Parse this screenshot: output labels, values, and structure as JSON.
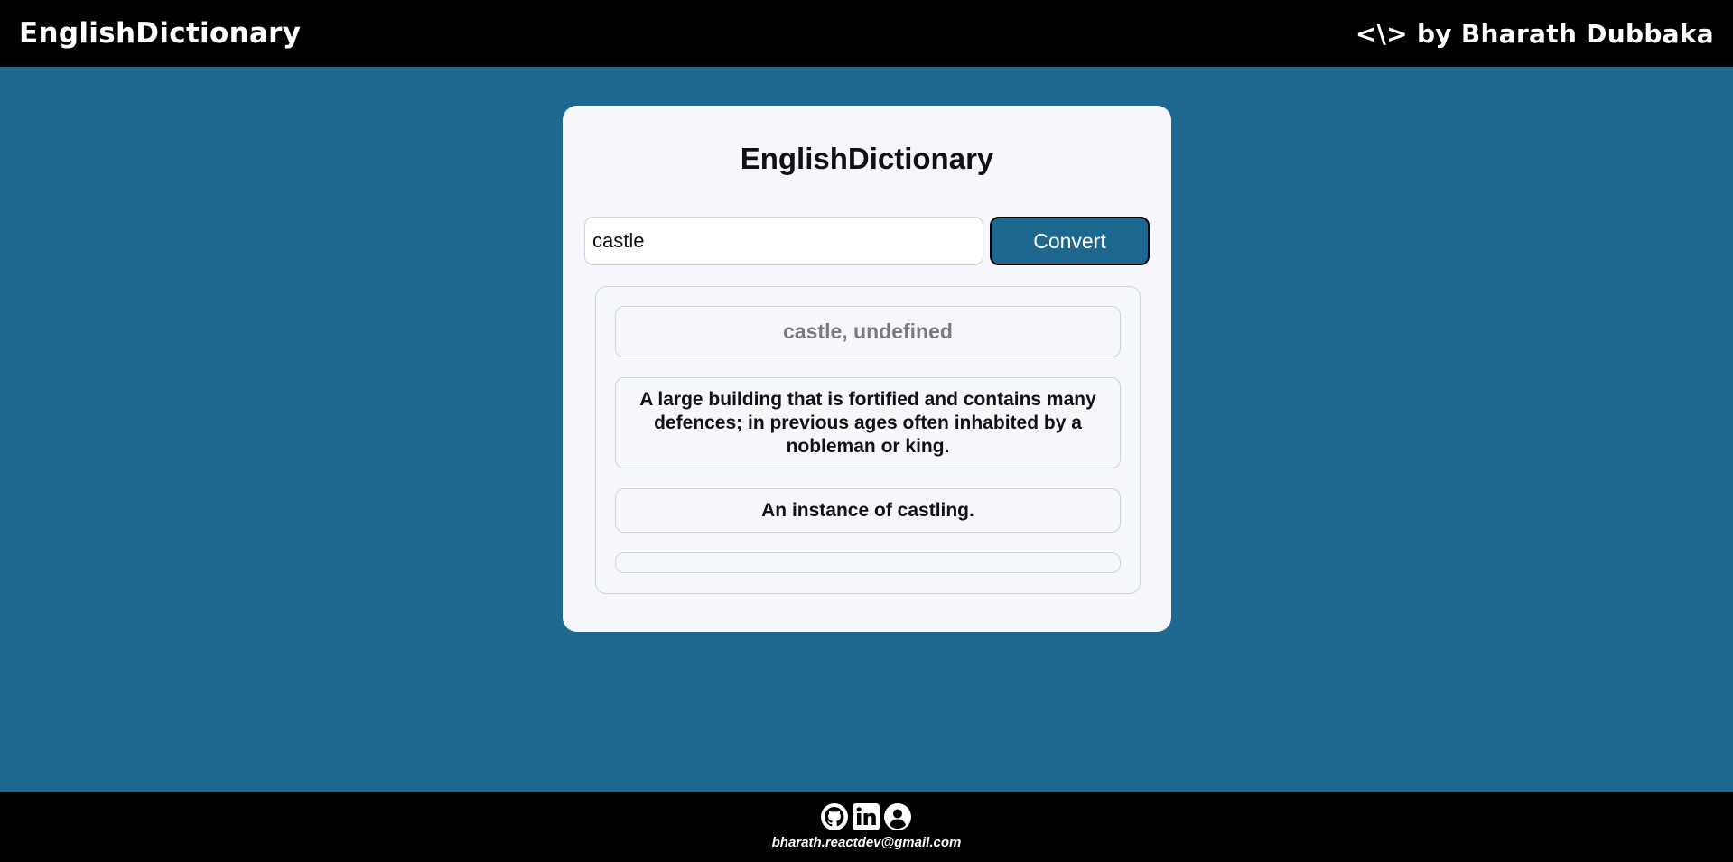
{
  "header": {
    "brand": "EnglishDictionary",
    "credit": "<\\> by Bharath Dubbaka"
  },
  "card": {
    "title": "EnglishDictionary",
    "search": {
      "value": "castle",
      "placeholder": ""
    },
    "convert_label": "Convert",
    "results": {
      "heading": "castle, undefined",
      "definitions": [
        "A large building that is fortified and contains many defences; in previous ages often inhabited by a nobleman or king.",
        "An instance of castling.",
        ""
      ]
    }
  },
  "footer": {
    "icons": [
      "github-icon",
      "linkedin-icon",
      "user-icon"
    ],
    "email": "bharath.reactdev@gmail.com"
  },
  "colors": {
    "background": "#1e6890",
    "bars": "#000000",
    "card": "#f5f7fd",
    "button": "#1e6890"
  }
}
